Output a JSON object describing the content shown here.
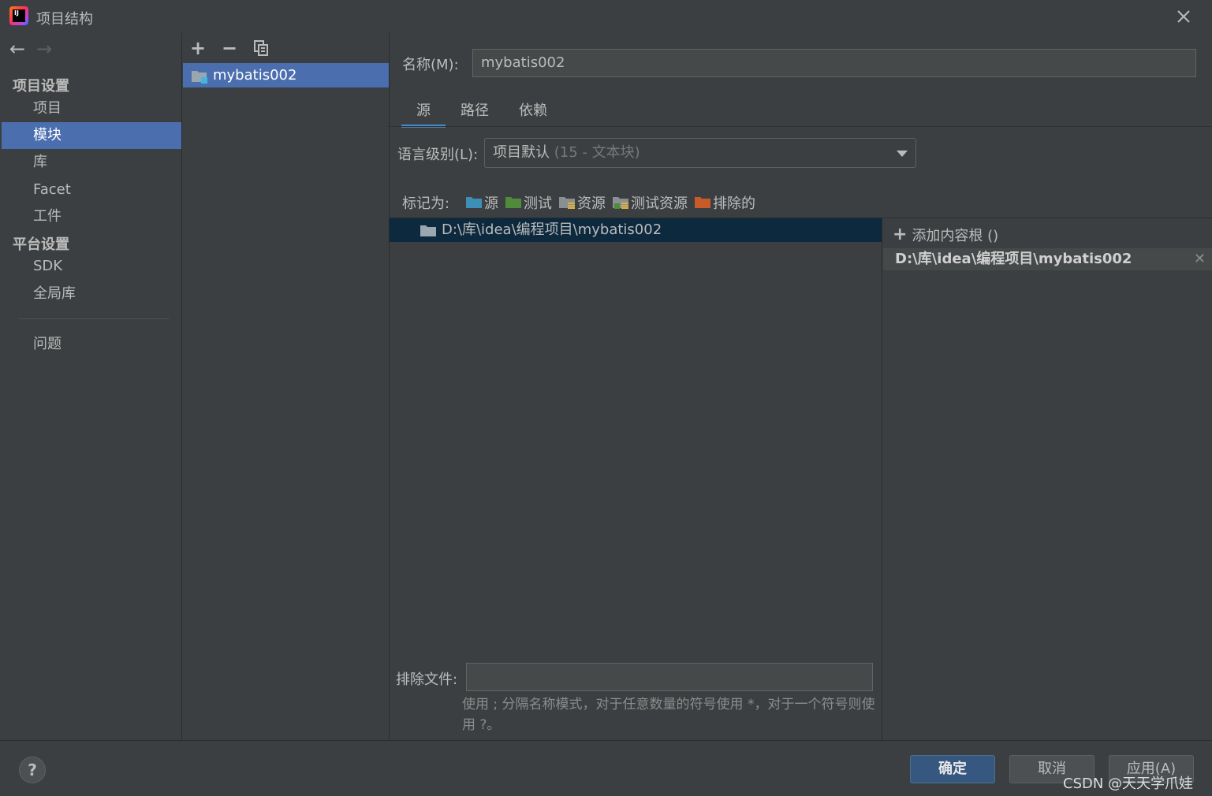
{
  "window": {
    "title": "项目结构",
    "close_icon": "close-icon"
  },
  "sidebar": {
    "group_project": "项目设置",
    "group_platform": "平台设置",
    "items": [
      {
        "label": "项目"
      },
      {
        "label": "模块"
      },
      {
        "label": "库"
      },
      {
        "label": "Facet"
      },
      {
        "label": "工件"
      },
      {
        "label": "SDK"
      },
      {
        "label": "全局库"
      },
      {
        "label": "问题"
      }
    ],
    "selected": "模块"
  },
  "modules": {
    "items": [
      "mybatis002"
    ]
  },
  "module": {
    "name_label": "名称(M):",
    "name_value": "mybatis002",
    "tabs": [
      "源",
      "路径",
      "依赖"
    ],
    "active_tab": "源",
    "lang_label": "语言级别(L):",
    "lang_value": "项目默认",
    "lang_hint": " (15 - 文本块)",
    "mark_label": "标记为:",
    "marks": [
      "源",
      "测试",
      "资源",
      "测试资源",
      "排除的"
    ],
    "tree_path": "D:\\库\\idea\\编程项目\\mybatis002",
    "excl_label": "排除文件:",
    "excl_value": "",
    "hint_text": "使用 ; 分隔名称模式，对于任意数量的符号使用 *，对于一个符号则使用 ?。",
    "add_root": "添加内容根 ()",
    "root_path": "D:\\库\\idea\\编程项目\\mybatis002"
  },
  "footer": {
    "ok": "确定",
    "cancel": "取消",
    "apply": "应用(A)",
    "watermark": "CSDN @天天学爪娃"
  },
  "colors": {
    "source": "#3d8fb5",
    "test": "#4f8b3a",
    "resource": "#8a8f93",
    "test_resource": "#8a8f93",
    "excluded": "#c75b2a",
    "selection": "#4b6eaf"
  }
}
